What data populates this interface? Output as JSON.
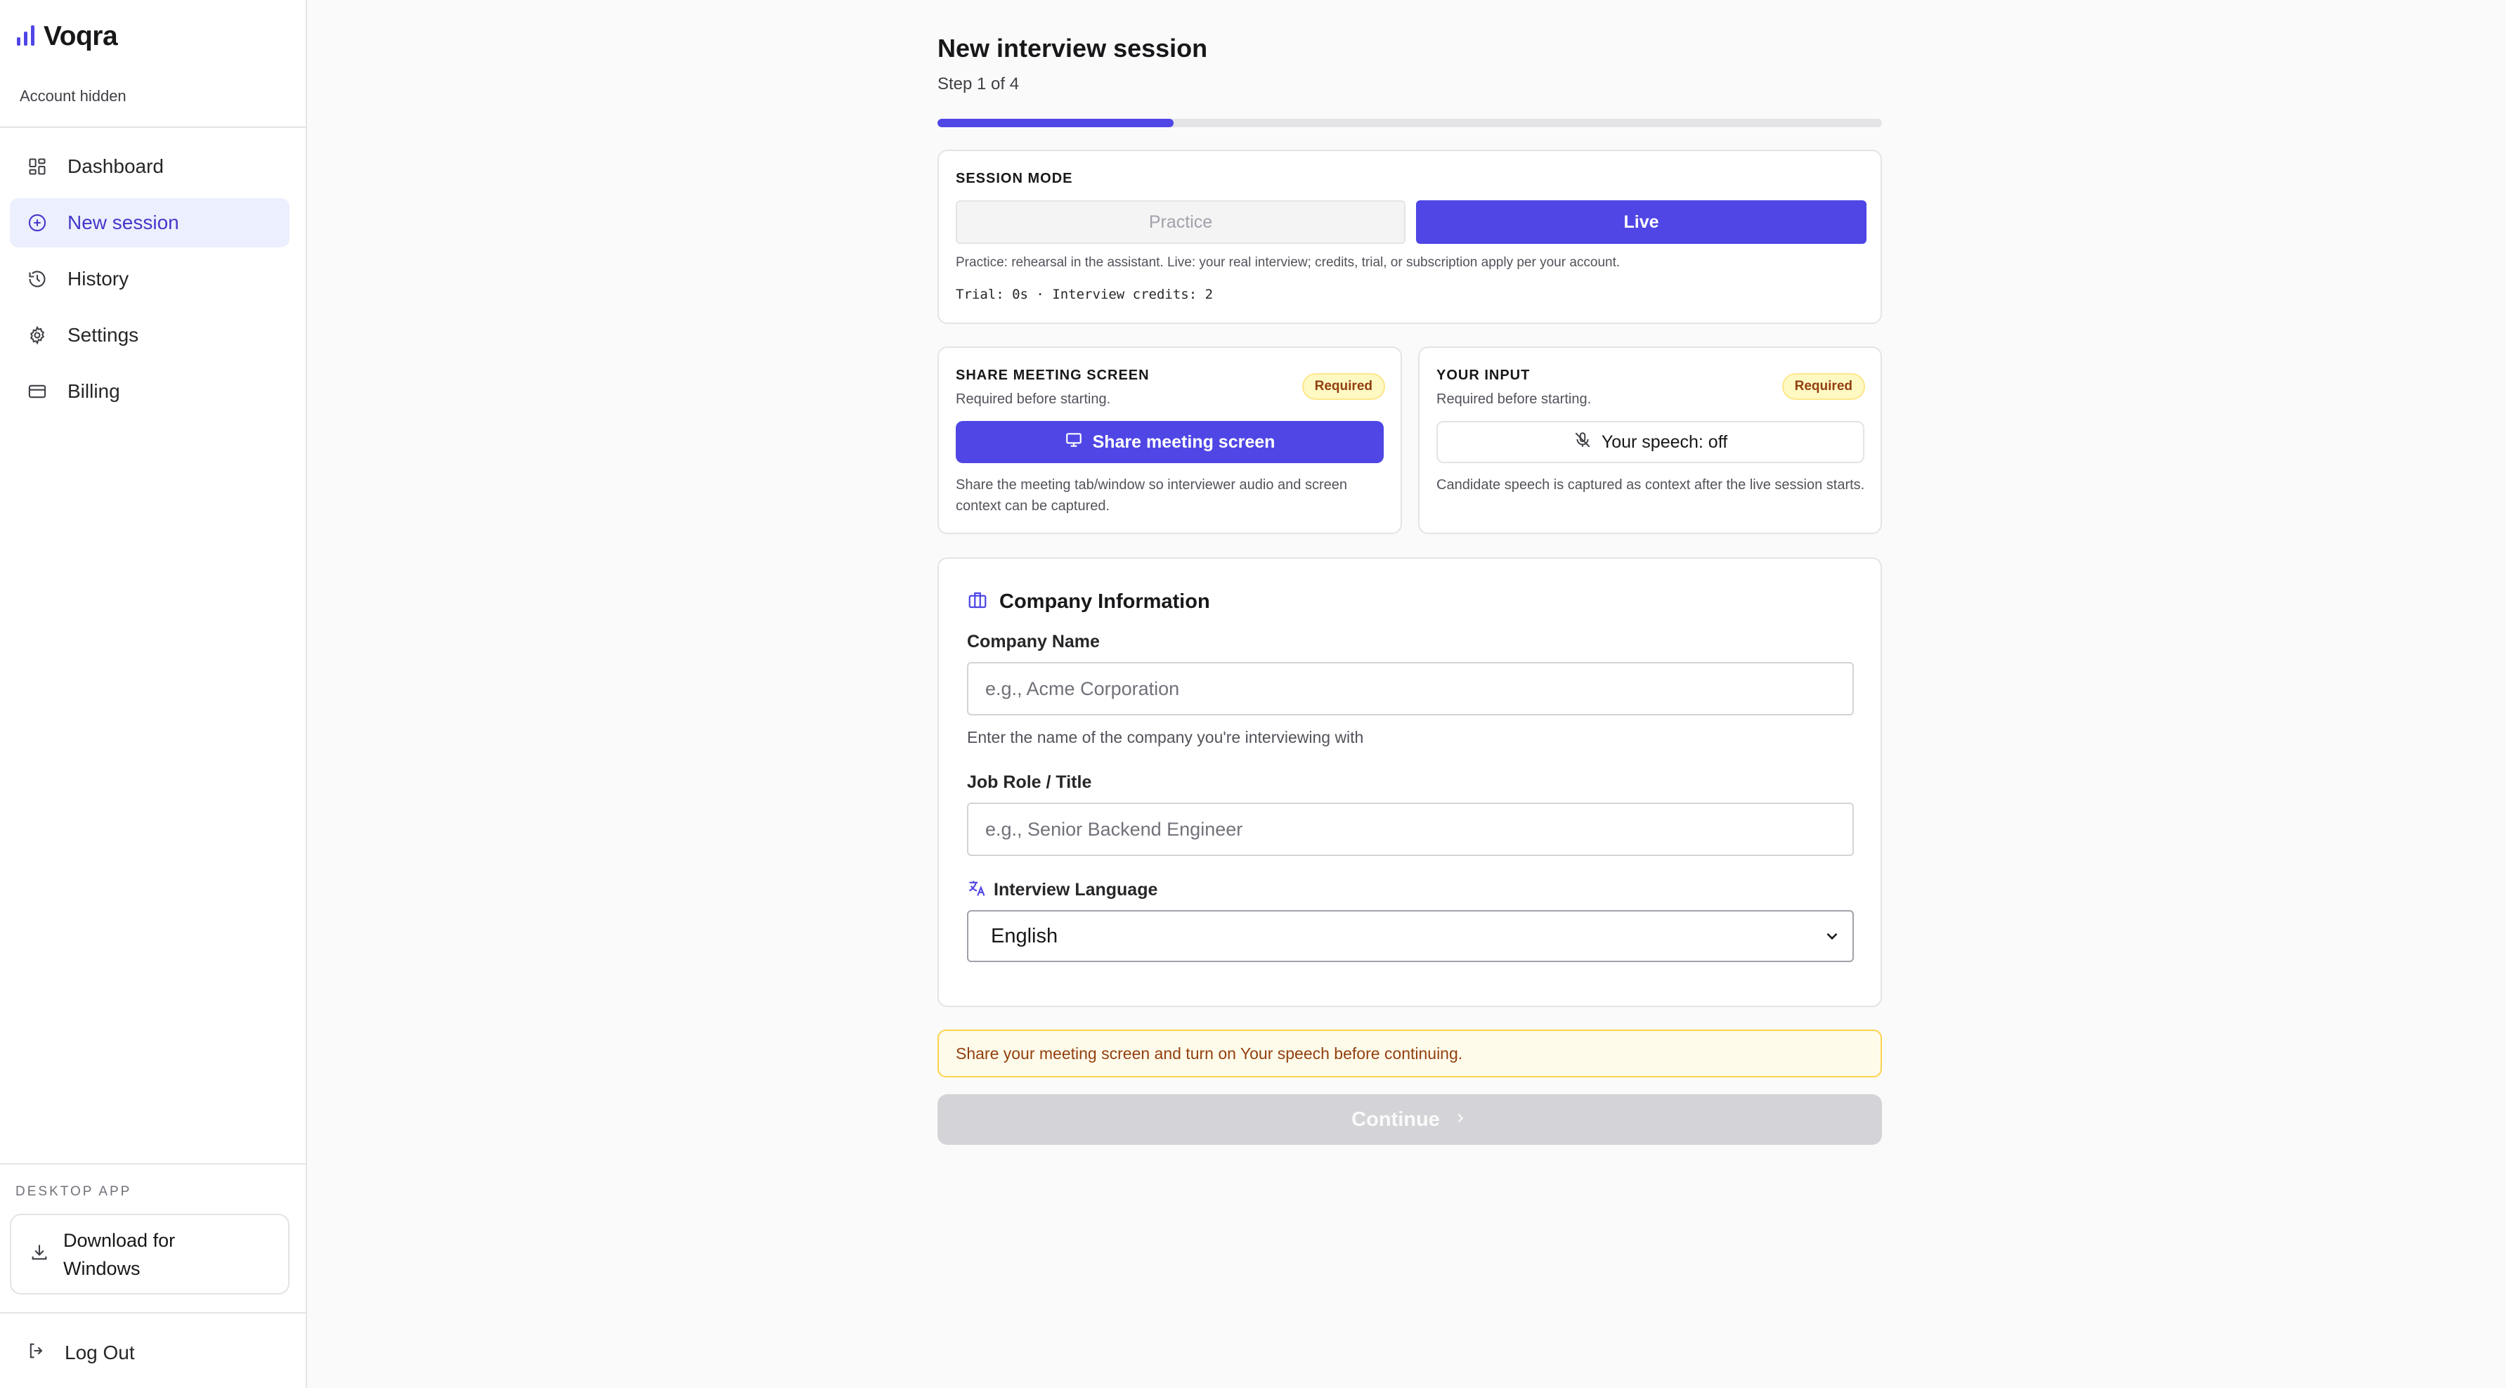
{
  "sidebar": {
    "brand": "Voqra",
    "account": "Account hidden",
    "items": [
      {
        "label": "Dashboard",
        "icon": "dashboard-icon",
        "active": false
      },
      {
        "label": "New session",
        "icon": "plus-circle-icon",
        "active": true
      },
      {
        "label": "History",
        "icon": "history-icon",
        "active": false
      },
      {
        "label": "Settings",
        "icon": "gear-icon",
        "active": false
      },
      {
        "label": "Billing",
        "icon": "credit-card-icon",
        "active": false
      }
    ],
    "desktop_label": "DESKTOP APP",
    "download_label": "Download for Windows",
    "logout_label": "Log Out"
  },
  "main": {
    "title": "New interview session",
    "step": "Step 1 of 4",
    "progress": 0.25,
    "mode": {
      "label": "SESSION MODE",
      "practice": "Practice",
      "live": "Live",
      "selected": "Live",
      "description": "Practice: rehearsal in the assistant. Live: your real interview; credits, trial, or subscription apply per your account.",
      "stats": "Trial: 0s · Interview credits: 2"
    },
    "share": {
      "label": "SHARE MEETING SCREEN",
      "note": "Required before starting.",
      "badge": "Required",
      "button": "Share meeting screen",
      "description": "Share the meeting tab/window so interviewer audio and screen context can be captured."
    },
    "input": {
      "label": "YOUR INPUT",
      "note": "Required before starting.",
      "badge": "Required",
      "button": "Your speech: off",
      "description": "Candidate speech is captured as context after the live session starts."
    },
    "company": {
      "title": "Company Information",
      "name_label": "Company Name",
      "name_placeholder": "e.g., Acme Corporation",
      "name_value": "",
      "name_hint": "Enter the name of the company you're interviewing with",
      "role_label": "Job Role / Title",
      "role_placeholder": "e.g., Senior Backend Engineer",
      "role_value": "",
      "language_label": "Interview Language",
      "language_value": "English"
    },
    "warning": "Share your meeting screen and turn on Your speech before continuing.",
    "continue": "Continue"
  },
  "colors": {
    "accent": "#4f46e5",
    "warning_bg": "#fffbeb",
    "warning_text": "#92400e"
  }
}
